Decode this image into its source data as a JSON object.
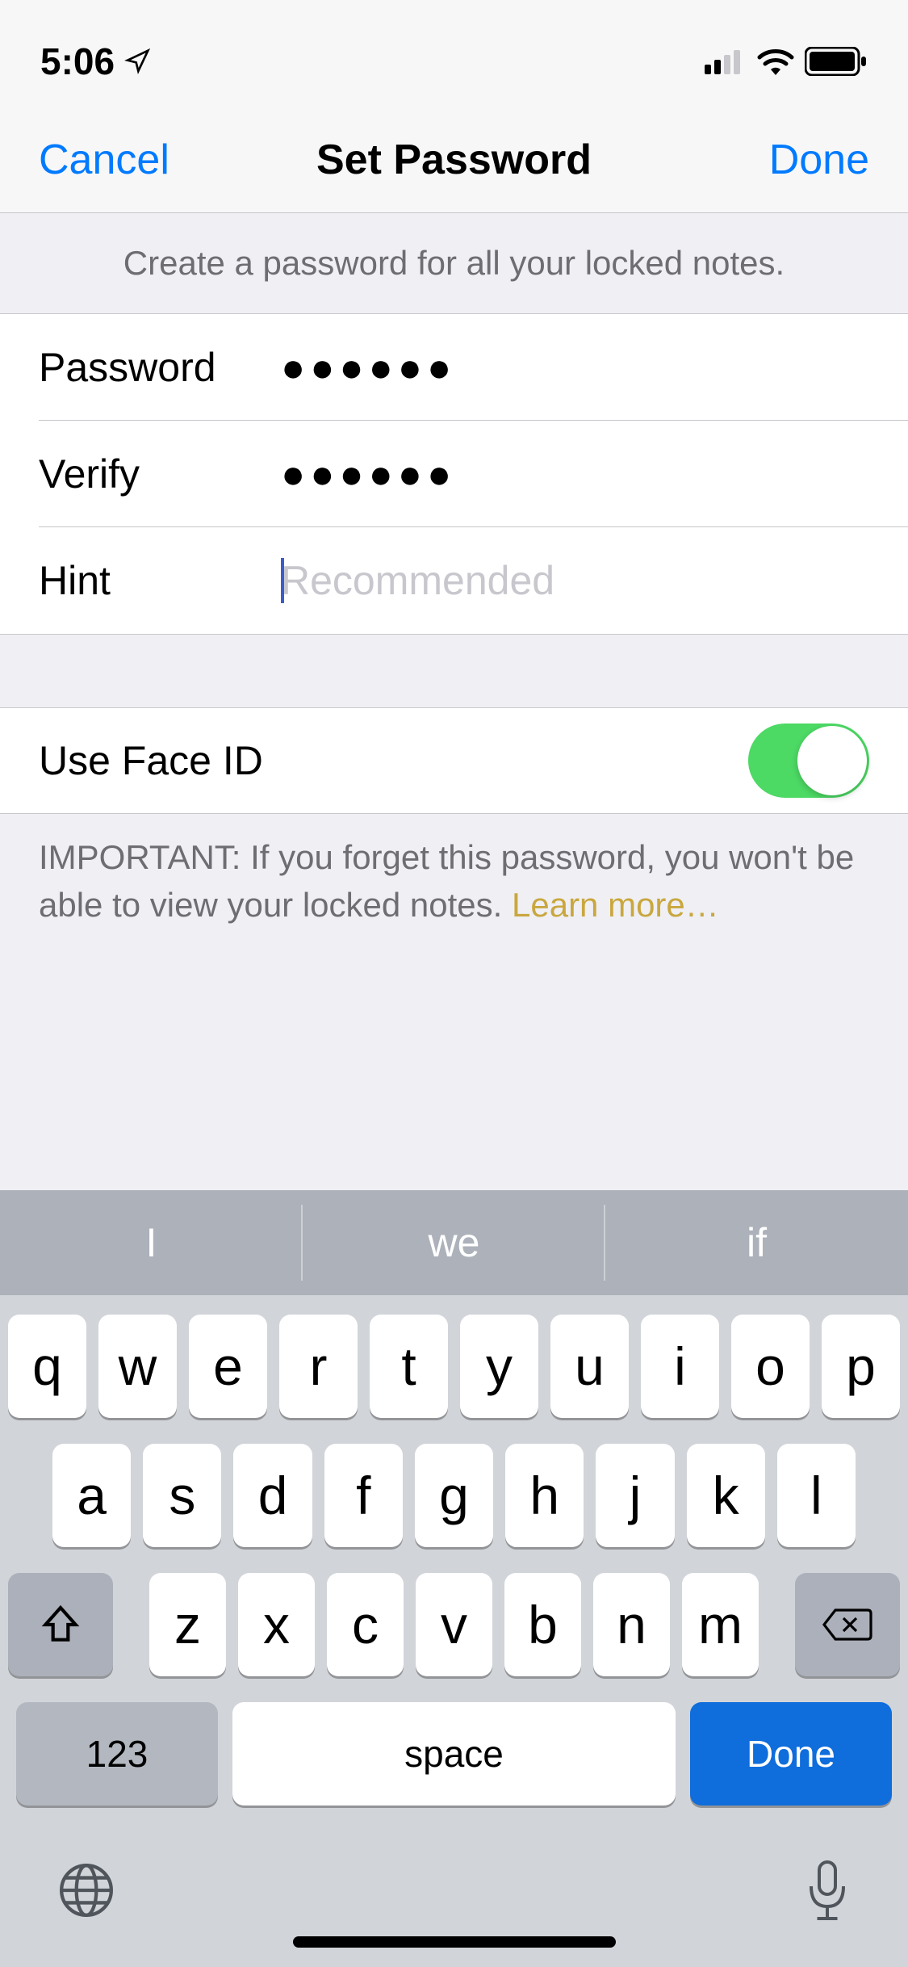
{
  "statusBar": {
    "time": "5:06"
  },
  "nav": {
    "cancel": "Cancel",
    "title": "Set Password",
    "done": "Done"
  },
  "description": "Create a password for all your locked notes.",
  "form": {
    "passwordLabel": "Password",
    "passwordValue": "●●●●●●",
    "verifyLabel": "Verify",
    "verifyValue": "●●●●●●",
    "hintLabel": "Hint",
    "hintPlaceholder": "Recommended"
  },
  "faceId": {
    "label": "Use Face ID",
    "enabled": true
  },
  "footer": {
    "prefix": "IMPORTANT: If you forget this password, you won't be able to view your locked notes. ",
    "link": "Learn more…"
  },
  "keyboard": {
    "suggestions": [
      "I",
      "we",
      "if"
    ],
    "row1": [
      "q",
      "w",
      "e",
      "r",
      "t",
      "y",
      "u",
      "i",
      "o",
      "p"
    ],
    "row2": [
      "a",
      "s",
      "d",
      "f",
      "g",
      "h",
      "j",
      "k",
      "l"
    ],
    "row3": [
      "z",
      "x",
      "c",
      "v",
      "b",
      "n",
      "m"
    ],
    "numKey": "123",
    "spaceKey": "space",
    "doneKey": "Done"
  }
}
